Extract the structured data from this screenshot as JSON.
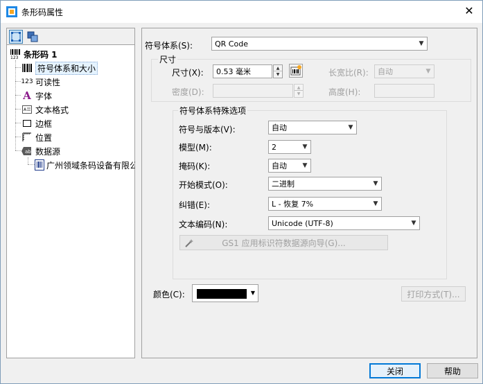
{
  "window": {
    "title": "条形码属性",
    "accent": "#0078d7"
  },
  "tree": {
    "root": "条形码 1",
    "items": [
      {
        "label": "符号体系和大小",
        "icon": "barcode-small-icon"
      },
      {
        "label": "可读性",
        "icon": "readability-123-icon",
        "icon_text": "123"
      },
      {
        "label": "字体",
        "icon": "font-icon",
        "icon_text": "A"
      },
      {
        "label": "文本格式",
        "icon": "text-format-icon"
      },
      {
        "label": "边框",
        "icon": "border-icon"
      },
      {
        "label": "位置",
        "icon": "position-icon"
      },
      {
        "label": "数据源",
        "icon": "datasource-icon",
        "icon_text": "ab"
      }
    ],
    "child": {
      "label": "广州领域条码设备有限公司",
      "icon": "barcode-document-icon"
    }
  },
  "symbology": {
    "label": "符号体系(S):",
    "value": "QR Code"
  },
  "size_group": {
    "title": "尺寸",
    "size_label": "尺寸(X):",
    "size_value": "0.53 毫米",
    "aspect_label": "长宽比(R):",
    "aspect_value": "自动",
    "density_label": "密度(D):",
    "density_value": "",
    "height_label": "高度(H):",
    "height_value": ""
  },
  "special": {
    "title": "符号体系特殊选项",
    "fields": [
      {
        "label": "符号与版本(V):",
        "value": "自动"
      },
      {
        "label": "模型(M):",
        "value": "2"
      },
      {
        "label": "掩码(K):",
        "value": "自动"
      },
      {
        "label": "开始模式(O):",
        "value": "二进制"
      },
      {
        "label": "纠错(E):",
        "value": "L - 恢复 7%"
      },
      {
        "label": "文本编码(N):",
        "value": "Unicode (UTF-8)"
      }
    ],
    "wizard_label": "GS1 应用标识符数据源向导(G)..."
  },
  "color": {
    "label": "颜色(C):",
    "value": "#000000"
  },
  "buttons": {
    "print_method": "打印方式(T)...",
    "close": "关闭",
    "help": "帮助"
  }
}
